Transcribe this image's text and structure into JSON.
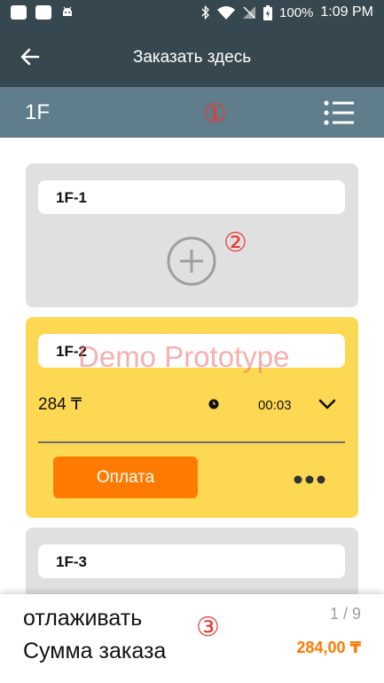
{
  "status_bar": {
    "battery_percent": "100%",
    "time": "1:09 PM",
    "icons": [
      "message-icon",
      "image-icon",
      "android-icon",
      "bluetooth-icon",
      "wifi-icon",
      "signal-icon",
      "battery-icon"
    ]
  },
  "header": {
    "title": "Заказать здесь",
    "back_icon": "arrow-left-icon"
  },
  "floor": {
    "name": "1F",
    "list_icon": "list-icon"
  },
  "annotations": {
    "m1": "①",
    "m2": "②",
    "m3": "③"
  },
  "tables": [
    {
      "name": "1F-1",
      "state": "empty"
    },
    {
      "name": "1F-2",
      "state": "occupied",
      "amount": "284 ₸",
      "timer": "00:03",
      "pay_label": "Оплата"
    },
    {
      "name": "1F-3",
      "state": "empty"
    }
  ],
  "watermark": "Demo Prototype",
  "footer": {
    "line1": "отлаживать",
    "line2": "Сумма заказа",
    "page": "1 / 9",
    "total": "284,00 ₸"
  },
  "colors": {
    "app_bar": "#37474f",
    "floor_bar": "#607d8b",
    "occupied_card": "#fdd853",
    "empty_card": "#e0e0e0",
    "accent": "#ff7a00",
    "marker": "#e53935"
  }
}
